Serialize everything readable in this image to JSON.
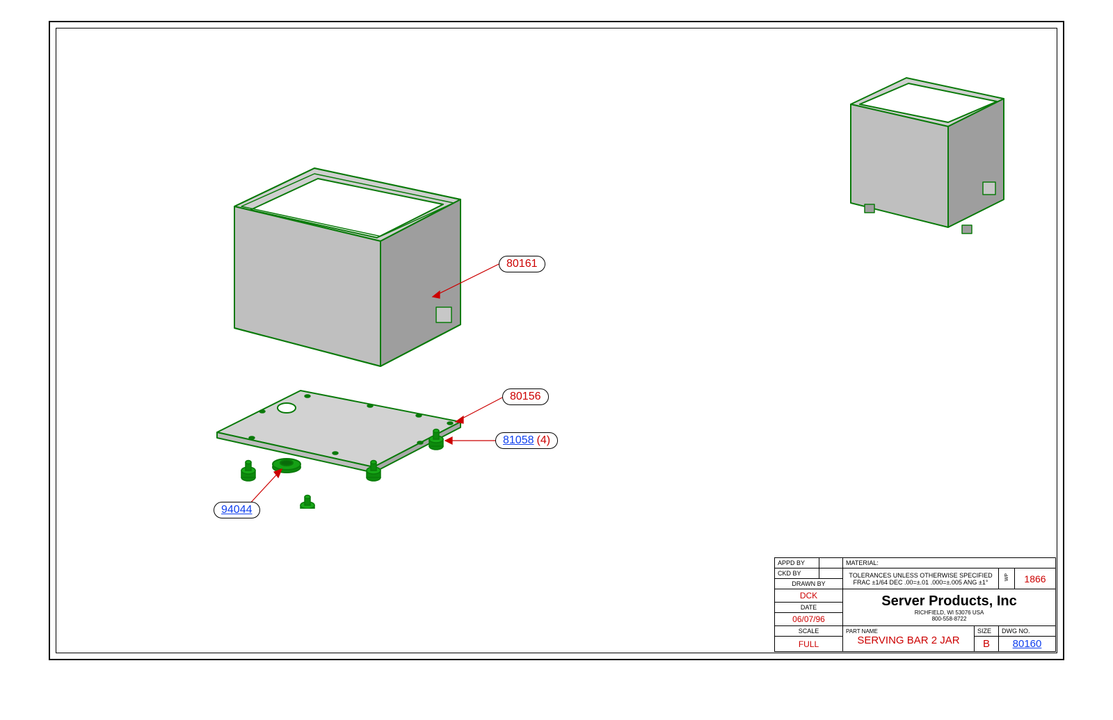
{
  "callouts": {
    "c1": {
      "pn": "80161",
      "link": false
    },
    "c2": {
      "pn": "80156",
      "link": false
    },
    "c3": {
      "pn": "81058",
      "qty": "(4)",
      "link": true
    },
    "c4": {
      "pn": "94044",
      "link": true
    }
  },
  "titleblock": {
    "appd_by_lbl": "APPD BY",
    "ckd_by_lbl": "CKD BY",
    "drawn_by_lbl": "DRAWN BY",
    "drawn_by": "DCK",
    "date_lbl": "DATE",
    "date": "06/07/96",
    "scale_lbl": "SCALE",
    "scale": "FULL",
    "material_lbl": "MATERIAL:",
    "tol_line1": "TOLERANCES UNLESS OTHERWISE SPECIFIED",
    "tol_line2": "FRAC ±1/64 DEC .00=±.01 .000=±.005 ANG ±1°",
    "wp_lbl": "WP",
    "wp": "1866",
    "company": "Server Products, Inc",
    "addr1": "RICHFIELD, WI 53076 USA",
    "addr2": "800-558-8722",
    "partname_lbl": "PART NAME",
    "partname": "SERVING BAR 2 JAR",
    "size_lbl": "SIZE",
    "size": "B",
    "dwg_lbl": "DWG NO.",
    "dwg": "80160"
  }
}
